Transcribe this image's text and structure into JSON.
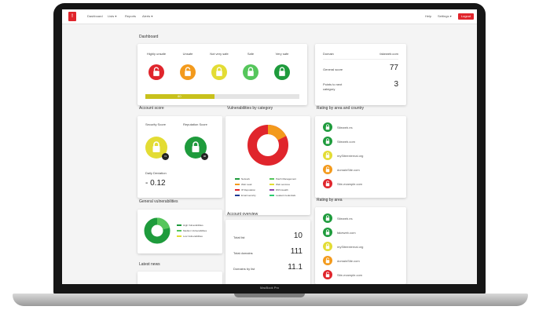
{
  "nav": {
    "logo_text": "!",
    "items": [
      "Dashboard",
      "Lists ▾",
      "Reports",
      "Alerts ▾"
    ],
    "help": "Help",
    "settings": "Settings ▾",
    "logout": "Logout"
  },
  "dashboard": {
    "title": "Dashboard",
    "levels": [
      {
        "label": "Highly unsafe",
        "color": "#e0252c",
        "icon": "lock-open-icon"
      },
      {
        "label": "Unsafe",
        "color": "#f39a1c",
        "icon": "lock-open-icon"
      },
      {
        "label": "Not very safe",
        "color": "#e3dc34",
        "icon": "lock-icon"
      },
      {
        "label": "Safe",
        "color": "#55c65b",
        "icon": "lock-icon"
      },
      {
        "label": "Very safe",
        "color": "#1e9b3c",
        "icon": "lock-icon"
      }
    ],
    "progress_fraction": 0.45,
    "progress_label": "60"
  },
  "domain_card": {
    "domain_label": "Domain",
    "domain_value": "fakeweb.com",
    "general_score_label": "General score",
    "general_score": "77",
    "points_label": "Points to next category",
    "points_value": "3"
  },
  "account_score": {
    "title": "Account score",
    "security_label": "Security Score",
    "reputation_label": "Reputation Score",
    "security_badge": "72",
    "reputation_badge": "96",
    "daily_label": "Daily Deviation",
    "daily_value": "- 0.12"
  },
  "vuln_category": {
    "title": "Vulnerabilities by category",
    "legend": [
      {
        "label": "Network",
        "color": "#1e9b3c"
      },
      {
        "label": "Patch Management",
        "color": "#55c65b"
      },
      {
        "label": "Web Leak",
        "color": "#f39a1c"
      },
      {
        "label": "Web services",
        "color": "#e3dc34"
      },
      {
        "label": "IP Reputation",
        "color": "#e0252c"
      },
      {
        "label": "DNS Health",
        "color": "#8e44ad"
      },
      {
        "label": "Email security",
        "color": "#1f3a93"
      },
      {
        "label": "Leaked credentials",
        "color": "#2ecc71"
      }
    ]
  },
  "general_vuln": {
    "title": "General vulnerabilities",
    "legend": [
      {
        "label": "High Vulnerabilities",
        "color": "#1e9b3c"
      },
      {
        "label": "Medium Vulnerabilities",
        "color": "#55c65b"
      },
      {
        "label": "Low Vulnerabilities",
        "color": "#e3dc34"
      }
    ]
  },
  "latest_news": {
    "title": "Latest news"
  },
  "account_overview": {
    "title": "Account overview",
    "rows": [
      {
        "label": "Total list",
        "value": "10"
      },
      {
        "label": "Total domains",
        "value": "111"
      },
      {
        "label": "Domains by list",
        "value": "11.1"
      }
    ]
  },
  "rating_area_country": {
    "title": "Rating by area and country",
    "rows": [
      {
        "label": "Siteweb.es",
        "color": "#1e9b3c",
        "icon": "lock-icon"
      },
      {
        "label": "Siteweb.com",
        "color": "#1e9b3c",
        "icon": "lock-icon"
      },
      {
        "label": "mySiteexternal.org",
        "color": "#e3dc34",
        "icon": "lock-icon"
      },
      {
        "label": "domainSite.com",
        "color": "#f39a1c",
        "icon": "lock-open-icon"
      },
      {
        "label": "Site-example.com",
        "color": "#e0252c",
        "icon": "lock-open-icon"
      }
    ]
  },
  "rating_area": {
    "title": "Rating by area",
    "rows": [
      {
        "label": "Siteweb.es",
        "color": "#1e9b3c",
        "icon": "lock-icon"
      },
      {
        "label": "fakeweb.com",
        "color": "#1e9b3c",
        "icon": "lock-icon"
      },
      {
        "label": "mySiteexternal.org",
        "color": "#e3dc34",
        "icon": "lock-icon"
      },
      {
        "label": "domainSite.com",
        "color": "#f39a1c",
        "icon": "lock-open-icon"
      },
      {
        "label": "Site-example.com",
        "color": "#e0252c",
        "icon": "lock-open-icon"
      }
    ]
  },
  "laptop": {
    "brand": "MacBook Pro"
  }
}
